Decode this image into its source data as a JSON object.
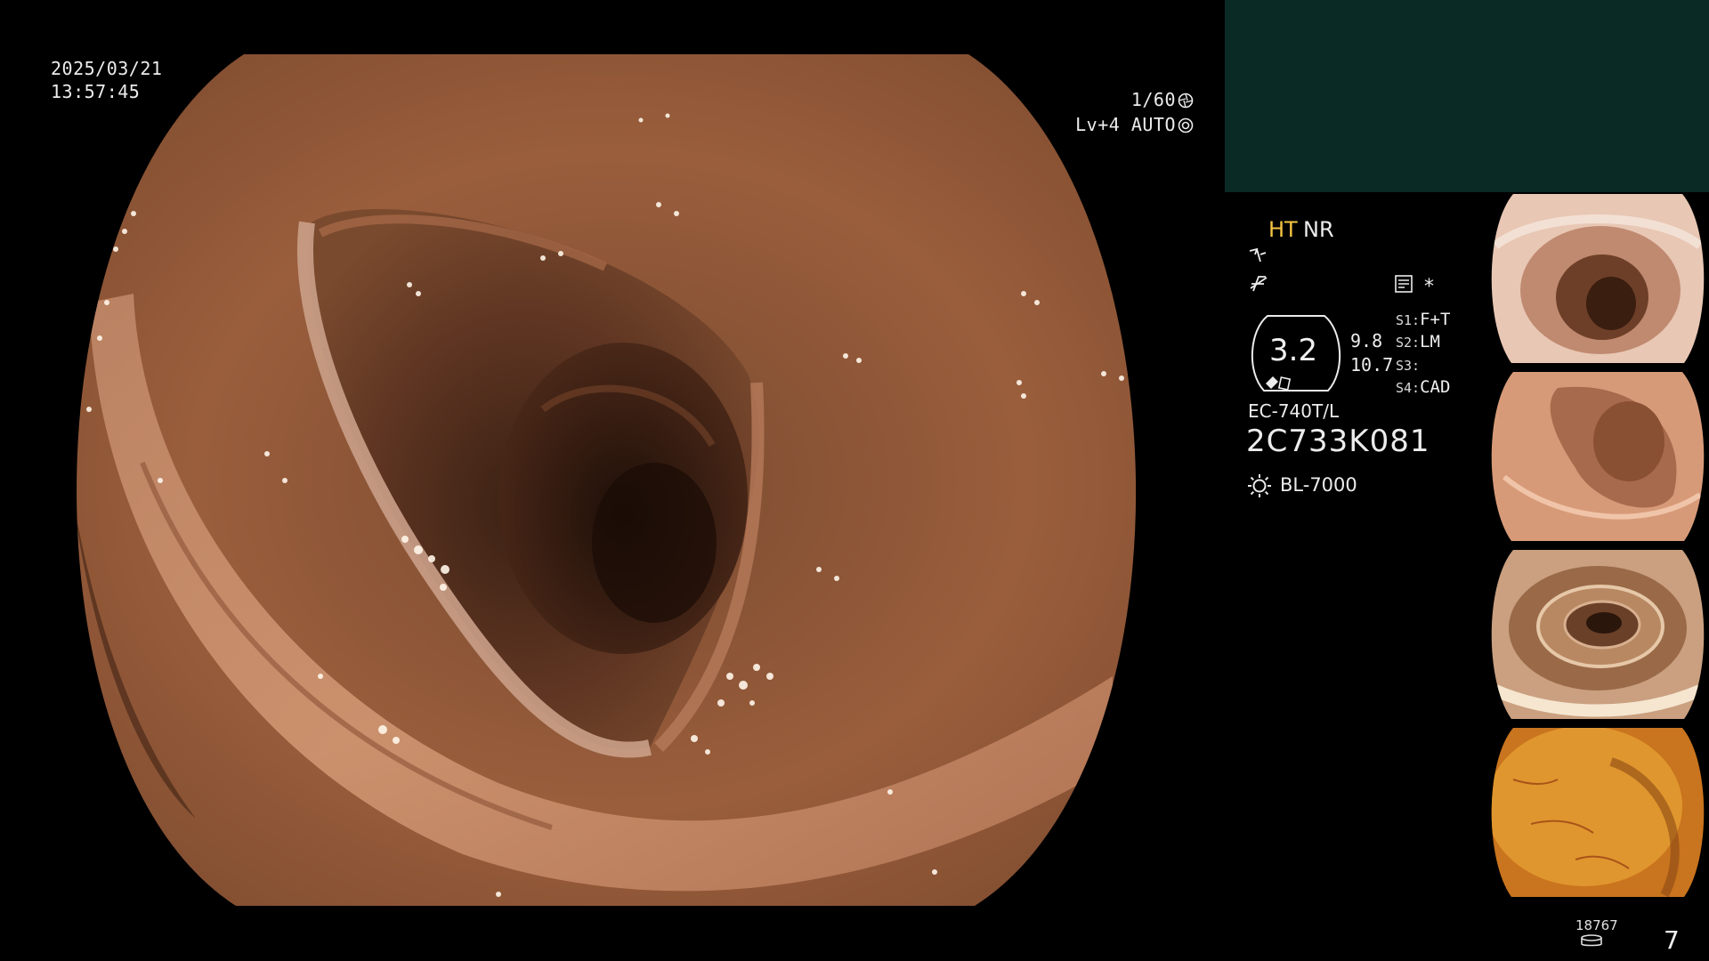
{
  "osd": {
    "date": "2025/03/21",
    "time": "13:57:45",
    "shutter": "1/60",
    "level": "Lv+4 AUTO",
    "shutter_icon": "aperture-icon",
    "iris_icon": "iris-icon"
  },
  "panel": {
    "mode_ht": "HT",
    "mode_nr": "NR",
    "zoom": "3.2",
    "zoom_upper": "9.8",
    "zoom_lower": "10.7",
    "switches": [
      {
        "key": "S1:",
        "value": "F+T"
      },
      {
        "key": "S2:",
        "value": "LM"
      },
      {
        "key": "S3:",
        "value": ""
      },
      {
        "key": "S4:",
        "value": "CAD"
      }
    ],
    "star": "*",
    "scope_model": "EC-740T/L",
    "scope_serial": "2C733K081",
    "light_source": "BL-7000",
    "record_counter": "18767",
    "page_number": "7"
  },
  "colors": {
    "panel_top": "#0a2a26",
    "accent_ht": "#f5c542",
    "tissue": "#9a5e3c"
  }
}
